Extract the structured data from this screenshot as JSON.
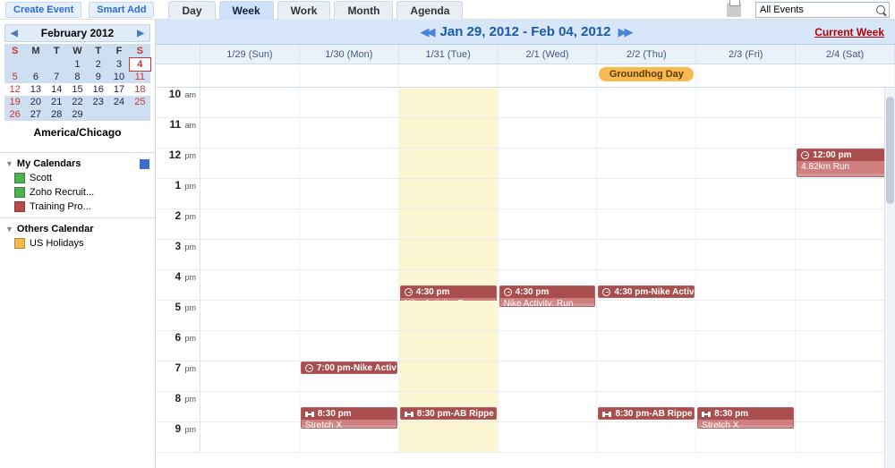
{
  "topbar": {
    "create_event": "Create Event",
    "smart_add": "Smart Add",
    "tabs": [
      "Day",
      "Week",
      "Work",
      "Month",
      "Agenda"
    ],
    "active_tab": "Week",
    "filter_label": "All Events"
  },
  "minical": {
    "title": "February 2012",
    "dow": [
      "S",
      "M",
      "T",
      "W",
      "T",
      "F",
      "S"
    ],
    "rows": [
      [
        "",
        "",
        "",
        "1",
        "2",
        "3",
        "4"
      ],
      [
        "5",
        "6",
        "7",
        "8",
        "9",
        "10",
        "11"
      ],
      [
        "12",
        "13",
        "14",
        "15",
        "16",
        "17",
        "18"
      ],
      [
        "19",
        "20",
        "21",
        "22",
        "23",
        "24",
        "25"
      ],
      [
        "26",
        "27",
        "28",
        "29",
        "",
        "",
        ""
      ]
    ],
    "today_cell": [
      0,
      6
    ],
    "current_week_row": 2,
    "timezone": "America/Chicago"
  },
  "calendars": {
    "my_label": "My Calendars",
    "my_items": [
      {
        "name": "Scott",
        "color": "#4caf50"
      },
      {
        "name": "Zoho Recruit...",
        "color": "#4caf50"
      },
      {
        "name": "Training Pro...",
        "color": "#b94a48"
      }
    ],
    "others_label": "Others Calendar",
    "others_items": [
      {
        "name": "US Holidays",
        "color": "#f2b84b"
      }
    ]
  },
  "header": {
    "range": "Jan 29, 2012 - Feb 04, 2012",
    "current_week_label": "Current Week",
    "days": [
      "1/29 (Sun)",
      "1/30 (Mon)",
      "1/31 (Tue)",
      "2/1 (Wed)",
      "2/2 (Thu)",
      "2/3 (Fri)",
      "2/4 (Sat)"
    ],
    "today_index": 2
  },
  "allday": [
    {
      "day": 4,
      "title": "Groundhog Day",
      "color": "#f9b94e"
    }
  ],
  "hours": [
    {
      "n": "10",
      "ap": "am"
    },
    {
      "n": "11",
      "ap": "am"
    },
    {
      "n": "12",
      "ap": "pm"
    },
    {
      "n": "1",
      "ap": "pm"
    },
    {
      "n": "2",
      "ap": "pm"
    },
    {
      "n": "3",
      "ap": "pm"
    },
    {
      "n": "4",
      "ap": "pm"
    },
    {
      "n": "5",
      "ap": "pm"
    },
    {
      "n": "6",
      "ap": "pm"
    },
    {
      "n": "7",
      "ap": "pm"
    },
    {
      "n": "8",
      "ap": "pm"
    },
    {
      "n": "9",
      "ap": "pm"
    }
  ],
  "events": [
    {
      "day": 6,
      "hour": 2,
      "offset": 0,
      "span": 1,
      "time": "12:00 pm",
      "title": "4.82km Run",
      "icon": "clock"
    },
    {
      "day": 2,
      "hour": 6,
      "offset": 17,
      "span": 0.75,
      "time": "4:30 pm",
      "title": "Nike Activity: Run",
      "icon": "clock"
    },
    {
      "day": 3,
      "hour": 6,
      "offset": 17,
      "span": 0.75,
      "time": "4:30 pm",
      "title": "Nike Activity: Run",
      "icon": "clock"
    },
    {
      "day": 4,
      "hour": 6,
      "offset": 17,
      "span": 0.4,
      "time": "4:30 pm-Nike Activit",
      "title": "",
      "icon": "clock",
      "compact": true
    },
    {
      "day": 1,
      "hour": 9,
      "offset": 0,
      "span": 0.4,
      "time": "7:00 pm-Nike Activit",
      "title": "",
      "icon": "clock",
      "compact": true
    },
    {
      "day": 1,
      "hour": 10,
      "offset": 17,
      "span": 0.75,
      "time": "8:30 pm",
      "title": "Stretch X",
      "icon": "dumbbell"
    },
    {
      "day": 2,
      "hour": 10,
      "offset": 17,
      "span": 0.4,
      "time": "8:30 pm-AB Rippe",
      "title": "",
      "icon": "dumbbell",
      "compact": true
    },
    {
      "day": 4,
      "hour": 10,
      "offset": 17,
      "span": 0.4,
      "time": "8:30 pm-AB Rippe",
      "title": "",
      "icon": "dumbbell",
      "compact": true
    },
    {
      "day": 5,
      "hour": 10,
      "offset": 17,
      "span": 0.75,
      "time": "8:30 pm",
      "title": "Stretch X",
      "icon": "dumbbell"
    }
  ]
}
